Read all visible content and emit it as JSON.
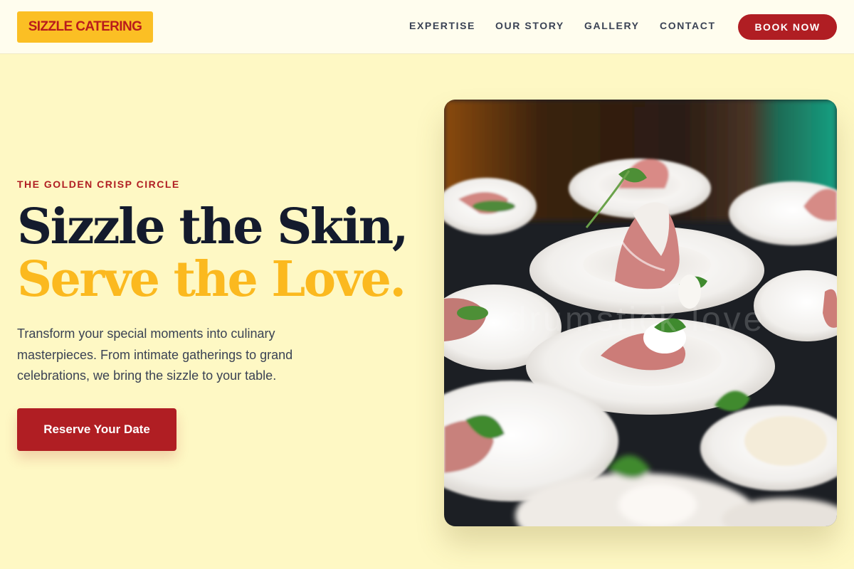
{
  "brand": {
    "logo_text": "SIZZLE CATERING"
  },
  "nav": {
    "links": [
      "EXPERTISE",
      "OUR STORY",
      "GALLERY",
      "CONTACT"
    ],
    "cta_label": "BOOK NOW"
  },
  "hero": {
    "eyebrow": "THE GOLDEN CRISP CIRCLE",
    "headline_line1": "Sizzle the Skin,",
    "headline_line2": "Serve the Love.",
    "description": "Transform your special moments into culinary masterpieces. From intimate gatherings to grand celebrations, we bring the sizzle to your table.",
    "cta_label": "Reserve Your Date",
    "image_watermark": "drumstick love"
  },
  "colors": {
    "background": "#fef8c4",
    "brand_red": "#b01e23",
    "brand_gold": "#fbbf24",
    "headline_dark": "#141b2d"
  }
}
